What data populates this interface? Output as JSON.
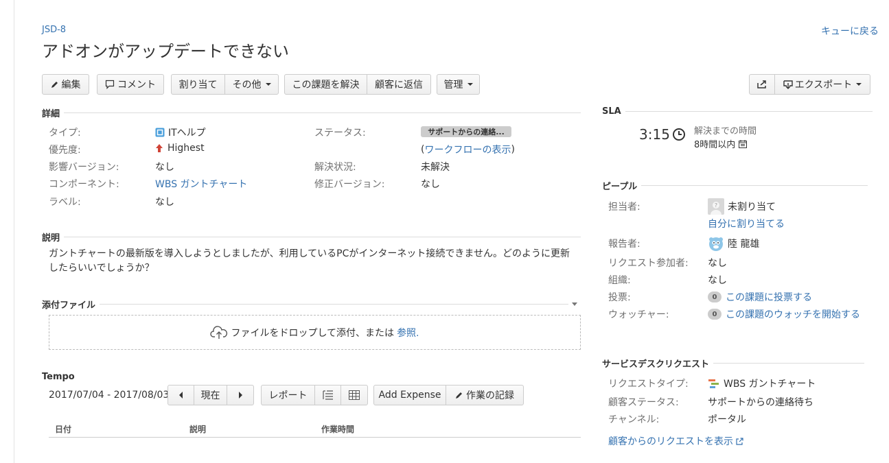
{
  "issue": {
    "key": "JSD-8",
    "title": "アドオンがアップデートできない",
    "back_link": "キューに戻る"
  },
  "toolbar": {
    "edit": "編集",
    "comment": "コメント",
    "assign": "割り当て",
    "more": "その他",
    "resolve": "この課題を解決",
    "reply": "顧客に返信",
    "admin": "管理",
    "export": "エクスポート"
  },
  "details": {
    "heading": "詳細",
    "type_label": "タイプ:",
    "type_value": "ITヘルプ",
    "priority_label": "優先度:",
    "priority_value": "Highest",
    "affects_label": "影響バージョン:",
    "affects_value": "なし",
    "component_label": "コンポーネント:",
    "component_value": "WBS ガントチャート",
    "labels_label": "ラベル:",
    "labels_value": "なし",
    "status_label": "ステータス:",
    "status_value": "サポートからの連絡...",
    "workflow_link": "ワークフローの表示",
    "resolution_label": "解決状況:",
    "resolution_value": "未解決",
    "fix_label": "修正バージョン:",
    "fix_value": "なし"
  },
  "description": {
    "heading": "説明",
    "text": "ガントチャートの最新版を導入しようとしましたが、利用しているPCがインターネット接続できません。どのように更新したらいいでしょうか？"
  },
  "attachments": {
    "heading": "添付ファイル",
    "drop_text": "ファイルをドロップして添付、または",
    "browse": "参照."
  },
  "tempo": {
    "heading": "Tempo",
    "range": "2017/07/04 - 2017/08/03",
    "current": "現在",
    "report": "レポート",
    "add_expense": "Add Expense",
    "log_work": "作業の記録",
    "col_date": "日付",
    "col_desc": "説明",
    "col_time": "作業時間"
  },
  "sla": {
    "heading": "SLA",
    "time": "3:15",
    "desc": "解決までの時間",
    "sub": "8時間以内"
  },
  "people": {
    "heading": "ピープル",
    "assignee_label": "担当者:",
    "assignee_value": "未割り当て",
    "assign_me": "自分に割り当てる",
    "reporter_label": "報告者:",
    "reporter_value": "陸 龍雄",
    "participants_label": "リクエスト参加者:",
    "participants_value": "なし",
    "org_label": "組織:",
    "org_value": "なし",
    "votes_label": "投票:",
    "votes_count": "0",
    "votes_link": "この課題に投票する",
    "watchers_label": "ウォッチャー:",
    "watchers_count": "0",
    "watchers_link": "この課題のウォッチを開始する"
  },
  "service_desk": {
    "heading": "サービスデスクリクエスト",
    "type_label": "リクエストタイプ:",
    "type_value": "WBS ガントチャート",
    "customer_status_label": "顧客ステータス:",
    "customer_status_value": "サポートからの連絡待ち",
    "channel_label": "チャンネル:",
    "channel_value": "ポータル",
    "view_link": "顧客からのリクエストを表示"
  }
}
